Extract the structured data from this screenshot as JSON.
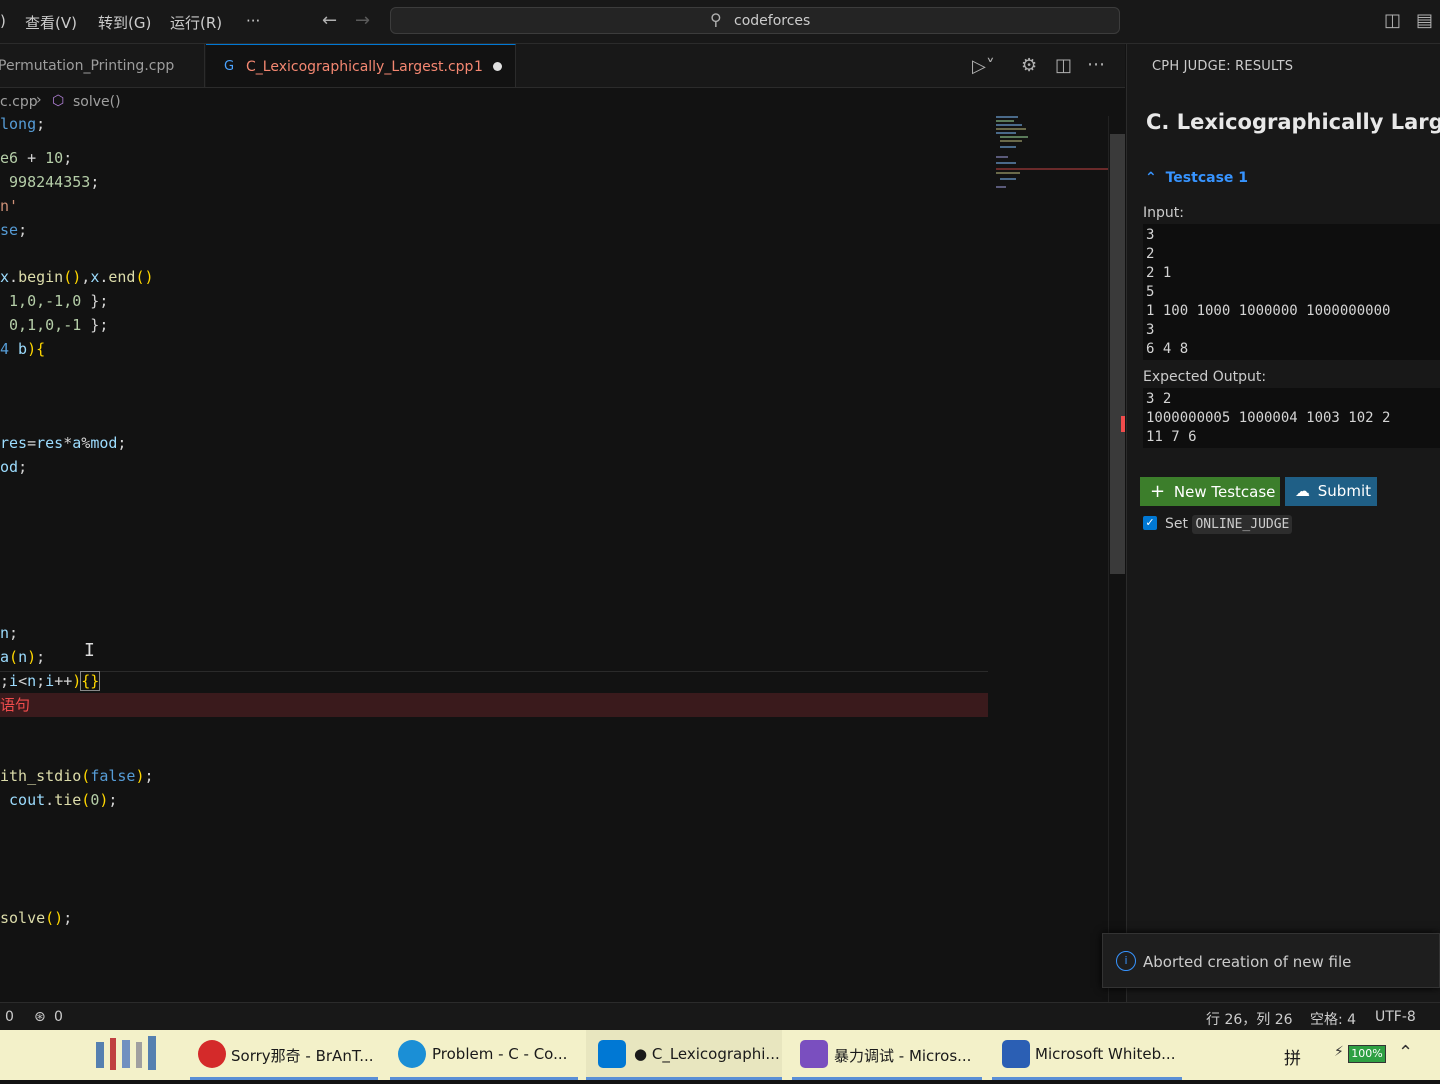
{
  "menu": {
    "view": "查看(V)",
    "goto": "转到(G)",
    "run": "运行(R)",
    "more": "···",
    "partial": ")"
  },
  "search": {
    "text": "codeforces"
  },
  "tabs": [
    {
      "label": "Permutation_Printing.cpp"
    },
    {
      "label": "C_Lexicographically_Largest.cpp",
      "problems": "1"
    }
  ],
  "breadcrumb": {
    "file": "c.cpp",
    "symbol": "solve()"
  },
  "panel": {
    "header": "CPH JUDGE: RESULTS",
    "problem_title": "C. Lexicographically Largest",
    "testcase": "Testcase 1",
    "input_label": "Input:",
    "input_lines": [
      "3",
      "2",
      "2 1",
      "5",
      "1 100 1000 1000000 1000000000",
      "3",
      "6 4 8"
    ],
    "expected_label": "Expected Output:",
    "expected_lines": [
      "3 2",
      "1000000005 1000004 1003 102 2",
      "11 7 6"
    ],
    "new_testcase": "New Testcase",
    "submit": "Submit",
    "set_label": "Set",
    "online_judge": "ONLINE_JUDGE"
  },
  "notification": {
    "text": "Aborted creation of new file"
  },
  "status": {
    "errors": "0",
    "ports": "0",
    "position": "行 26，列 26",
    "spaces": "空格: 4",
    "encoding": "UTF-8"
  },
  "taskbar": {
    "items": [
      {
        "label": "Sorry那奇 - BrAnT..."
      },
      {
        "label": "Problem - C - Co..."
      },
      {
        "label": "● C_Lexicographi..."
      },
      {
        "label": "暴力调试 - Micros..."
      },
      {
        "label": "Microsoft Whiteb..."
      }
    ],
    "ime": "拼",
    "battery": "100%"
  },
  "colors": {
    "accent": "#0078d4",
    "error": "#f14c4c",
    "tab_modified": "#f48771",
    "new_btn": "#3c7e2b",
    "submit_btn": "#1f5f86"
  }
}
